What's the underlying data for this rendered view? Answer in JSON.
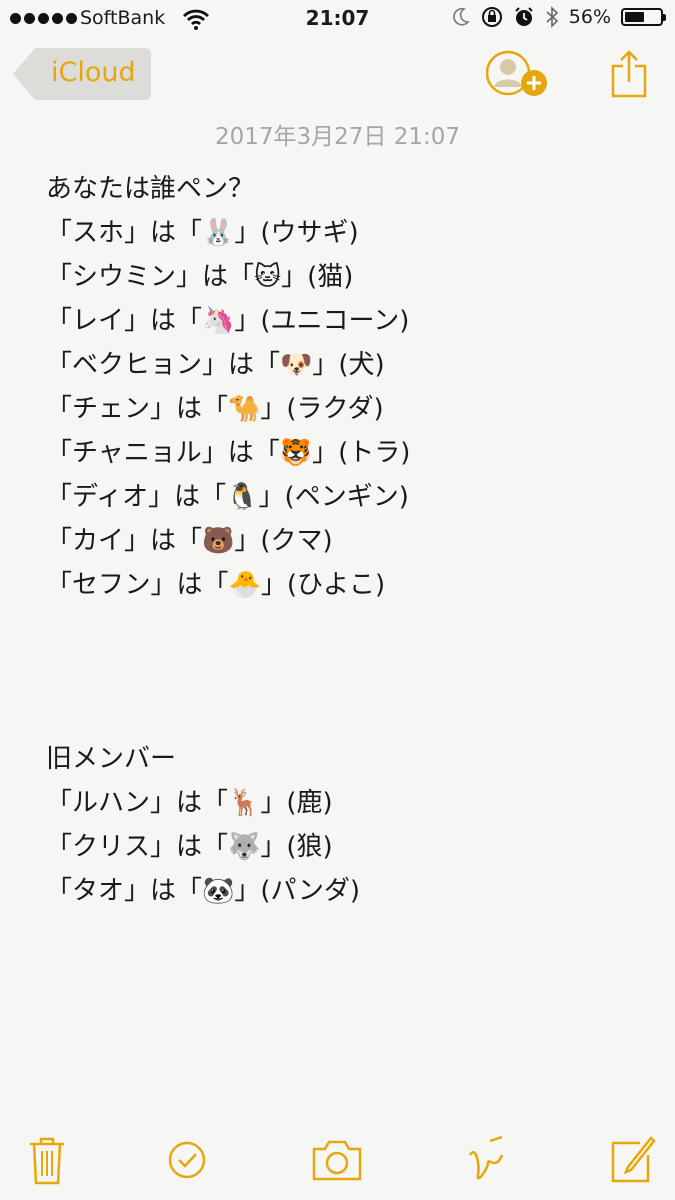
{
  "status_bar": {
    "carrier": "SoftBank",
    "time": "21:07",
    "battery_percent": "56%",
    "battery_level": 0.56
  },
  "nav": {
    "back_label": "iCloud"
  },
  "note": {
    "timestamp": "2017年3月27日 21:07",
    "lines_a": [
      "あなたは誰ペン？",
      "「スホ」は「🐰」(ウサギ)",
      "「シウミン」は「🐱」(猫)",
      "「レイ」は「🦄」(ユニコーン)",
      "「ベクヒョン」は「🐶」(犬)",
      "「チェン」は「🐪」(ラクダ)",
      "「チャニョル」は「🐯」(トラ)",
      "「ディオ」は「🐧」(ペンギン)",
      "「カイ」は「🐻」(クマ)",
      "「セフン」は「🐣」(ひよこ)"
    ],
    "lines_b": [
      "旧メンバー",
      "「ルハン」は「🦌」(鹿)",
      "「クリス」は「🐺」(狼)",
      "「タオ」は「🐼」(パンダ)"
    ]
  },
  "icons": {
    "accent": "#e6a70c",
    "toolbar": [
      "trash-icon",
      "checklist-icon",
      "camera-icon",
      "sketch-icon",
      "compose-icon"
    ]
  }
}
